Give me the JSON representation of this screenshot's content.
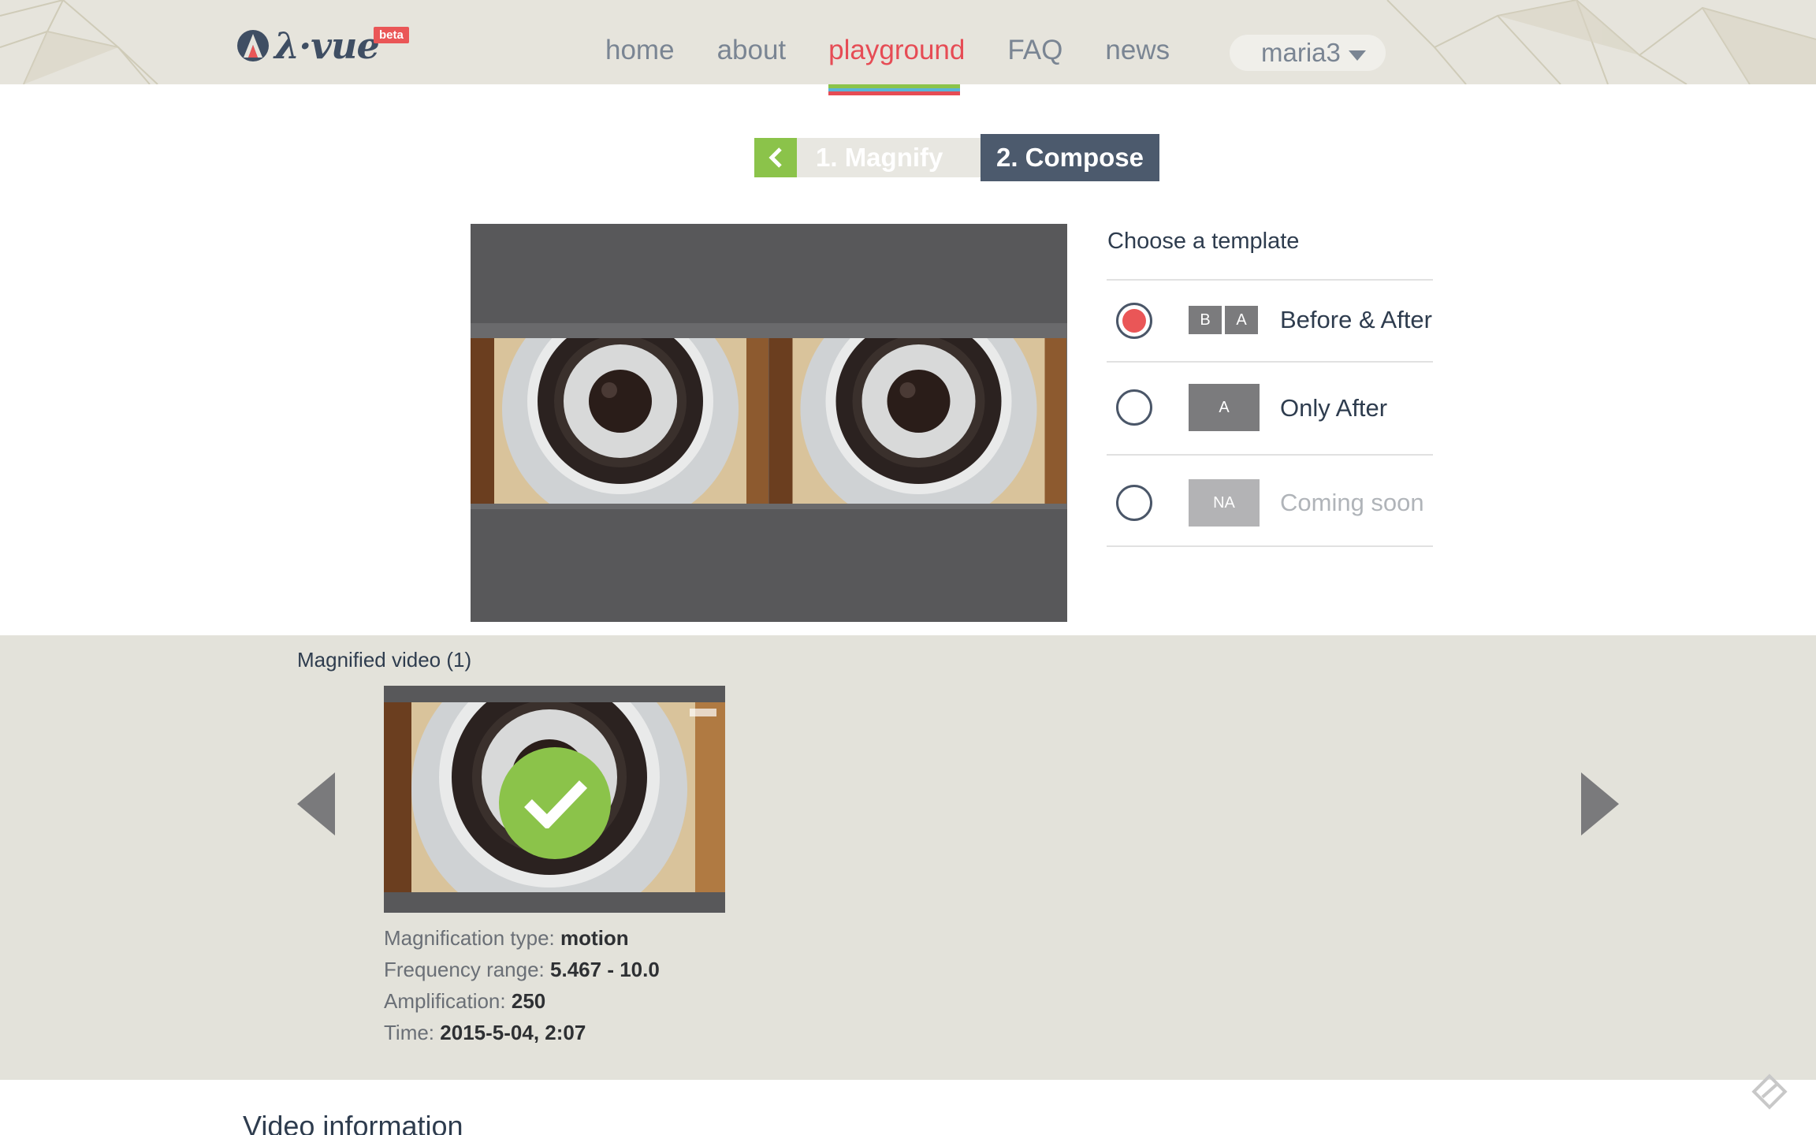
{
  "brand": {
    "name": "λ·vue",
    "badge": "beta"
  },
  "nav": {
    "items": [
      {
        "label": "home",
        "active": false
      },
      {
        "label": "about",
        "active": false
      },
      {
        "label": "playground",
        "active": true
      },
      {
        "label": "FAQ",
        "active": false
      },
      {
        "label": "news",
        "active": false
      }
    ],
    "user": "maria3"
  },
  "steps": {
    "step1": "1. Magnify",
    "step2": "2. Compose"
  },
  "templates": {
    "heading": "Choose a template",
    "options": [
      {
        "icon": [
          "B",
          "A"
        ],
        "label": "Before & After",
        "selected": true,
        "available": true
      },
      {
        "icon": [
          "A"
        ],
        "label": "Only After",
        "selected": false,
        "available": true
      },
      {
        "icon": [
          "NA"
        ],
        "label": "Coming soon",
        "selected": false,
        "available": false
      }
    ]
  },
  "gallery": {
    "title": "Magnified video (1)",
    "video": {
      "type_label": "Magnification type:",
      "type_value": "motion",
      "freq_label": "Frequency range:",
      "freq_value": "5.467 - 10.0",
      "amp_label": "Amplification:",
      "amp_value": "250",
      "time_label": "Time:",
      "time_value": "2015-5-04, 2:07"
    }
  },
  "section": {
    "title": "Video information"
  },
  "colors": {
    "accent_red": "#e64c55",
    "accent_green": "#8bc34a",
    "dark_slate": "#4c5a6d"
  }
}
